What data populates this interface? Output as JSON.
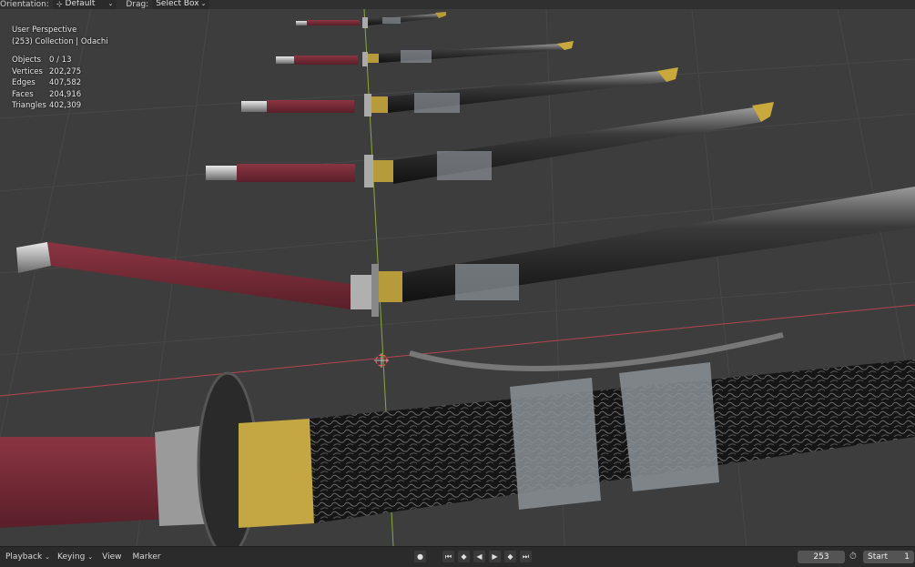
{
  "header": {
    "orientation_label": "Orientation:",
    "orientation_value": "Default",
    "drag_label": "Drag:",
    "drag_value": "Select Box"
  },
  "overlay": {
    "view_name": "User Perspective",
    "collection": "(253) Collection | Odachi",
    "stats": [
      {
        "label": "Objects",
        "value": "0 / 13"
      },
      {
        "label": "Vertices",
        "value": "202,275"
      },
      {
        "label": "Edges",
        "value": "407,582"
      },
      {
        "label": "Faces",
        "value": "204,916"
      },
      {
        "label": "Triangles",
        "value": "402,309"
      }
    ]
  },
  "timeline": {
    "playback": "Playback",
    "keying": "Keying",
    "view": "View",
    "marker": "Marker",
    "current_frame": "253",
    "start_label": "Start",
    "start_value": "1"
  },
  "colors": {
    "viewport_bg": "#3d3d3d",
    "grid_line": "#474747",
    "x_axis": "#b5454d",
    "y_axis": "#8aa83c",
    "handle": "#7a2a36",
    "scabbard": "#1c1c1c",
    "gold": "#b79a3a"
  },
  "icons": {
    "orientation": "gizmo-icon",
    "record": "record-icon",
    "clock": "stopwatch-icon"
  }
}
